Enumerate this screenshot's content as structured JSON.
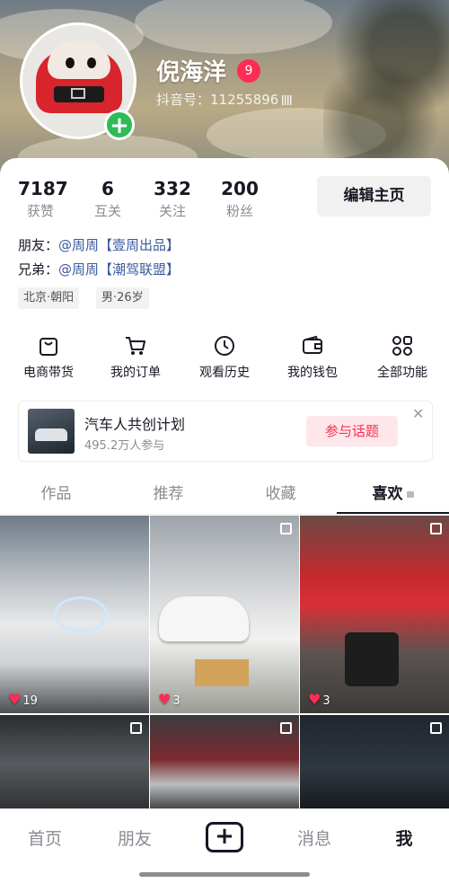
{
  "profile": {
    "nickname": "倪海洋",
    "level": "9",
    "douyin_id": "抖音号：11255896"
  },
  "stats": [
    {
      "num": "7187",
      "label": "获赞"
    },
    {
      "num": "6",
      "label": "互关"
    },
    {
      "num": "332",
      "label": "关注"
    },
    {
      "num": "200",
      "label": "粉丝"
    }
  ],
  "edit_label": "编辑主页",
  "relations": [
    {
      "prefix": "朋友：",
      "link": "@周周【壹周出品】"
    },
    {
      "prefix": "兄弟：",
      "link": "@周周【潮驾联盟】"
    }
  ],
  "tags": [
    "北京·朝阳",
    "男·26岁"
  ],
  "functions": [
    {
      "label": "电商带货",
      "icon": "shopping-bag-icon"
    },
    {
      "label": "我的订单",
      "icon": "cart-icon"
    },
    {
      "label": "观看历史",
      "icon": "clock-icon"
    },
    {
      "label": "我的钱包",
      "icon": "wallet-icon"
    },
    {
      "label": "全部功能",
      "icon": "grid-icon"
    }
  ],
  "promo": {
    "title": "汽车人共创计划",
    "subtitle": "495.2万人参与",
    "button": "参与话题",
    "close": "✕"
  },
  "tabs": [
    {
      "label": "作品"
    },
    {
      "label": "推荐"
    },
    {
      "label": "收藏"
    },
    {
      "label": "喜欢",
      "active": true,
      "locked": true
    }
  ],
  "grid": [
    {
      "likes": "19"
    },
    {
      "likes": "3"
    },
    {
      "likes": "3"
    },
    {
      "likes": ""
    },
    {
      "likes": ""
    },
    {
      "likes": ""
    }
  ],
  "bottom_nav": [
    {
      "label": "首页"
    },
    {
      "label": "朋友"
    },
    {
      "label": "+"
    },
    {
      "label": "消息"
    },
    {
      "label": "我",
      "active": true
    }
  ],
  "colors": {
    "accent": "#fe2c55",
    "green_plus": "#2dbb55",
    "link": "#3a5ba0"
  }
}
